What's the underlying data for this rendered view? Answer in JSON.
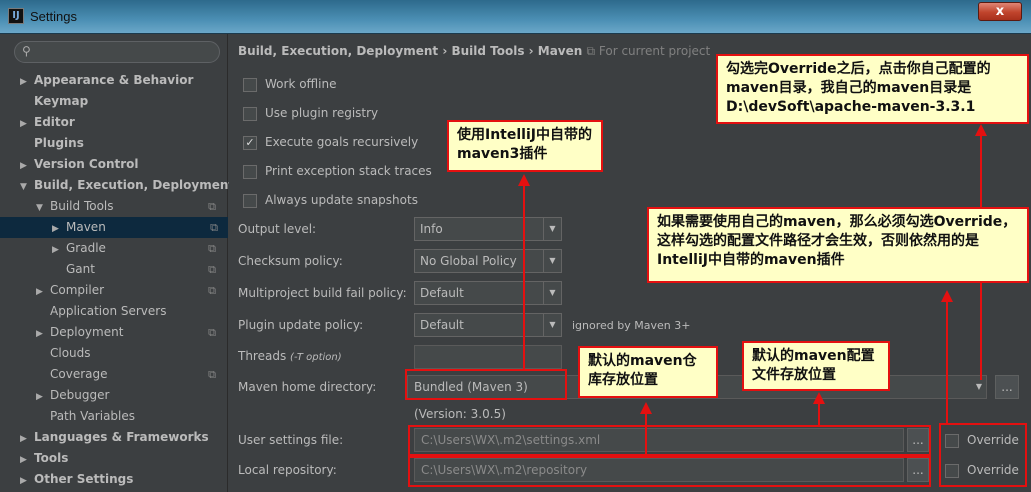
{
  "window": {
    "title": "Settings",
    "close_label": "x"
  },
  "sidebar": {
    "search_placeholder": "",
    "items": [
      {
        "label": "Appearance & Behavior"
      },
      {
        "label": "Keymap"
      },
      {
        "label": "Editor"
      },
      {
        "label": "Plugins"
      },
      {
        "label": "Version Control"
      },
      {
        "label": "Build, Execution, Deployment"
      },
      {
        "label": "Build Tools"
      },
      {
        "label": "Maven"
      },
      {
        "label": "Gradle"
      },
      {
        "label": "Gant"
      },
      {
        "label": "Compiler"
      },
      {
        "label": "Application Servers"
      },
      {
        "label": "Deployment"
      },
      {
        "label": "Clouds"
      },
      {
        "label": "Coverage"
      },
      {
        "label": "Debugger"
      },
      {
        "label": "Path Variables"
      },
      {
        "label": "Languages & Frameworks"
      },
      {
        "label": "Tools"
      },
      {
        "label": "Other Settings"
      }
    ]
  },
  "breadcrumb": {
    "text": "Build, Execution, Deployment › Build Tools › Maven",
    "project": "For current project"
  },
  "options": {
    "work_offline": "Work offline",
    "use_plugin_registry": "Use plugin registry",
    "execute_goals": "Execute goals recursively",
    "print_exception": "Print exception stack traces",
    "always_update": "Always update snapshots"
  },
  "fields": {
    "output_level_label": "Output level:",
    "output_level_value": "Info",
    "checksum_label": "Checksum policy:",
    "checksum_value": "No Global Policy",
    "multiproject_label": "Multiproject build fail policy:",
    "multiproject_value": "Default",
    "plugin_update_label": "Plugin update policy:",
    "plugin_update_value": "Default",
    "plugin_update_note": "ignored by Maven 3+",
    "threads_label": "Threads",
    "threads_hint": "(-T option)",
    "home_label": "Maven home directory:",
    "home_value": "Bundled (Maven 3)",
    "version": "(Version: 3.0.5)",
    "user_settings_label": "User settings file:",
    "user_settings_value": "C:\\Users\\WX\\.m2\\settings.xml",
    "local_repo_label": "Local repository:",
    "local_repo_value": "C:\\Users\\WX\\.m2\\repository",
    "browse": "...",
    "override": "Override"
  },
  "annotations": {
    "top_right": "勾选完Override之后，点击你自己配置的maven目录，我自己的maven目录是D:\\devSoft\\apache-maven-3.3.1",
    "bundled": "使用IntelliJ中自带的maven3插件",
    "override_note": "如果需要使用自己的maven，那么必须勾选Override，这样勾选的配置文件路径才会生效，否则依然用的是IntelliJ中自带的maven插件",
    "repo_note": "默认的maven仓库存放位置",
    "settings_note": "默认的maven配置文件存放位置"
  }
}
